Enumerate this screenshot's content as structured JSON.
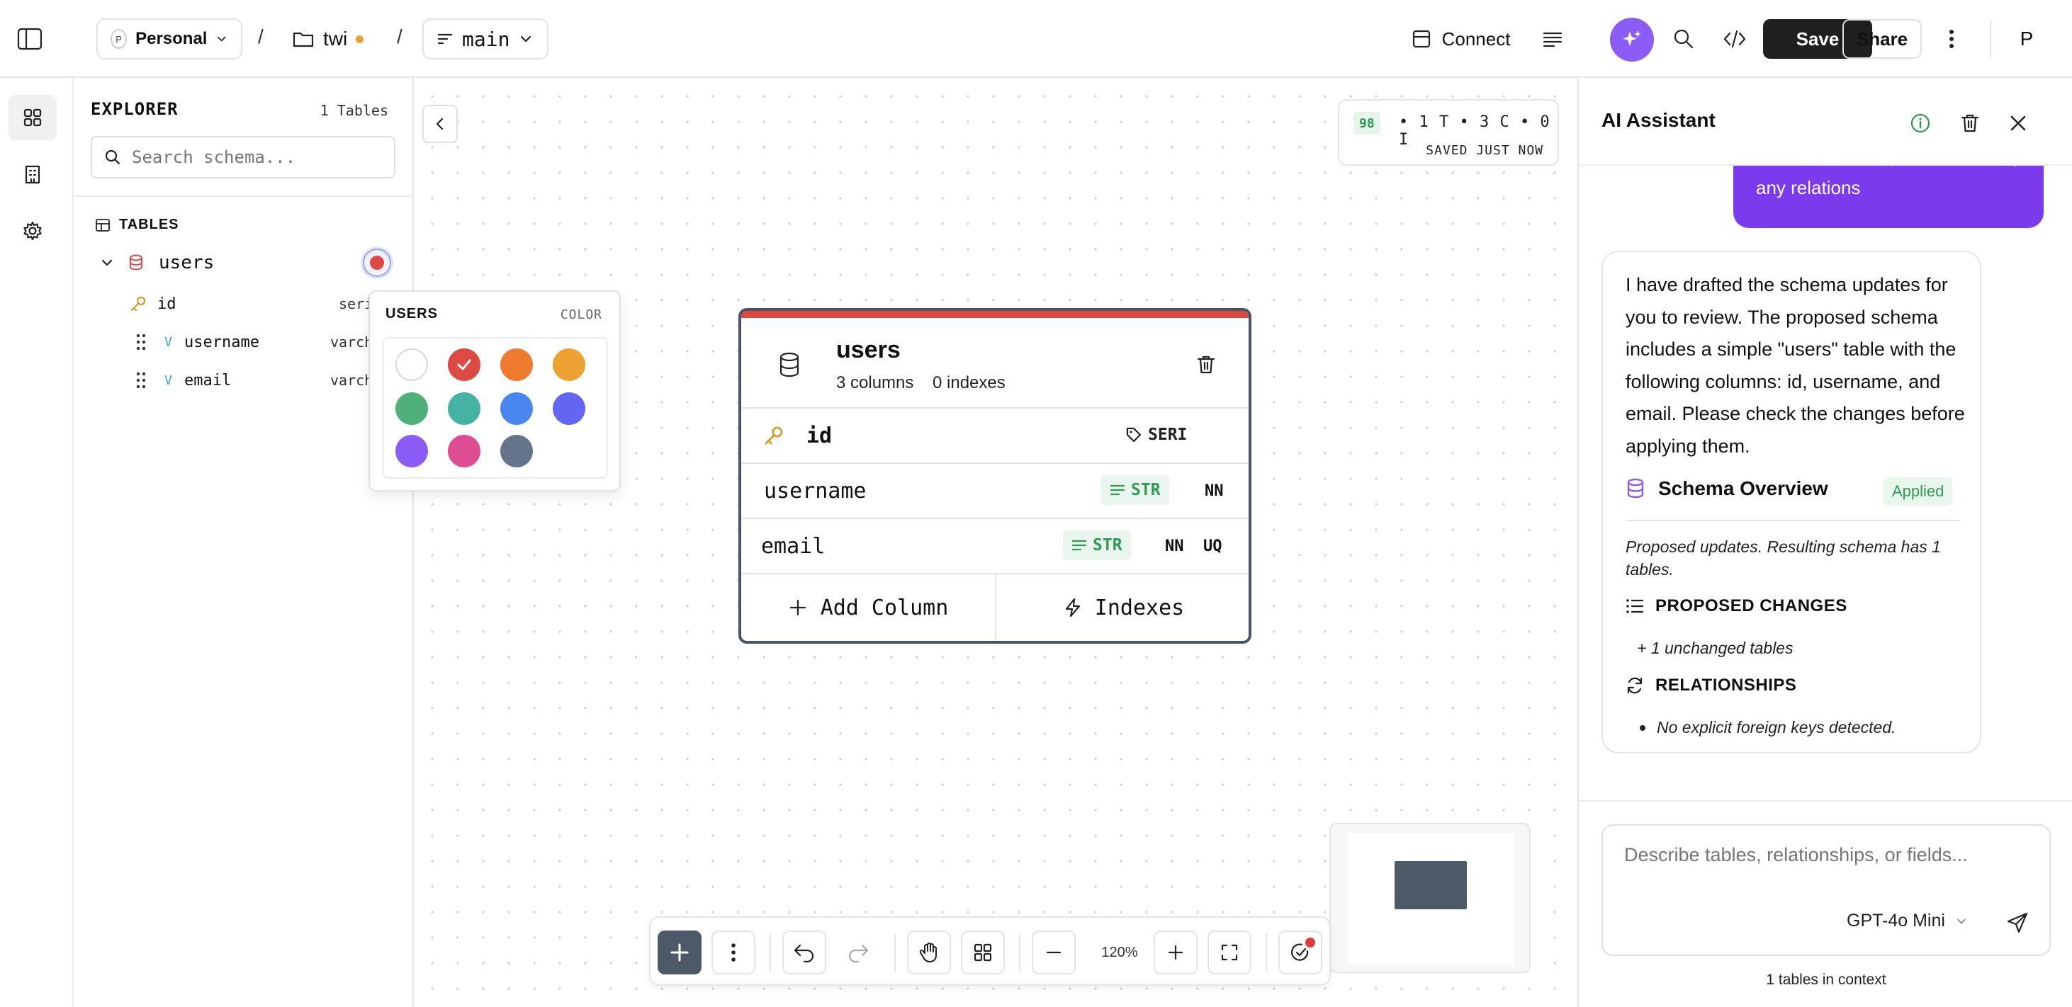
{
  "topbar": {
    "workspace_initial": "P",
    "workspace": "Personal",
    "separator": "/",
    "project": "twi",
    "branch": "main",
    "connect": "Connect",
    "save": "Save",
    "share": "Share",
    "avatar": "P",
    "accent_color": "#8b5cf6"
  },
  "explorer": {
    "title": "EXPLORER",
    "count": "1 Tables",
    "search_placeholder": "Search schema...",
    "section": "TABLES",
    "table_name": "users",
    "columns": [
      {
        "name": "id",
        "type": "seri"
      },
      {
        "name": "username",
        "type": "varch"
      },
      {
        "name": "email",
        "type": "varch"
      }
    ]
  },
  "color_picker": {
    "title": "USERS",
    "label": "COLOR",
    "colors": [
      "#ffffff",
      "#dc4a43",
      "#ee7b30",
      "#eda133",
      "#4fb07a",
      "#45b3a3",
      "#4a86ef",
      "#6366f1",
      "#8b5cf6",
      "#de4c94",
      "#64748b"
    ],
    "selected": "#dc4a43"
  },
  "canvas": {
    "stat_badge": "98",
    "stats": "• 1 T • 3 C • 0 I",
    "saved": "SAVED JUST NOW",
    "zoom": "120%"
  },
  "table_card": {
    "name": "users",
    "columns_count": "3 columns",
    "indexes_count": "0 indexes",
    "accent": "#dc4a43",
    "rows": [
      {
        "name": "id",
        "tag": "SERI",
        "flags": []
      },
      {
        "name": "username",
        "tag": "STR",
        "flags": [
          "NN"
        ]
      },
      {
        "name": "email",
        "tag": "STR",
        "flags": [
          "NN",
          "UQ"
        ]
      }
    ],
    "add_column": "Add Column",
    "indexes": "Indexes"
  },
  "assistant": {
    "title": "AI Assistant",
    "user_message": "Create me a simple table having any relations",
    "reply": "I have drafted the schema updates for you to review. The proposed schema includes a simple \"users\" table with the following columns: id, username, and email. Please check the changes before applying them.",
    "overview_title": "Schema Overview",
    "applied": "Applied",
    "proposed_note": "Proposed updates. Resulting schema has 1 tables.",
    "changes_title": "PROPOSED CHANGES",
    "changes_item": "+ 1 unchanged tables",
    "relationships_title": "RELATIONSHIPS",
    "relationships_item": "No explicit foreign keys detected.",
    "input_placeholder": "Describe tables, relationships, or fields...",
    "model": "GPT-4o Mini",
    "context": "1 tables in context"
  }
}
